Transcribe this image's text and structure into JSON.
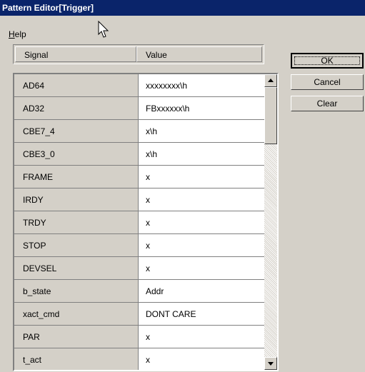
{
  "window": {
    "title": "Pattern Editor[Trigger]"
  },
  "menu": {
    "help_label": "Help"
  },
  "table": {
    "columns": {
      "signal": "Signal",
      "value": "Value"
    },
    "rows": [
      {
        "signal": "AD64",
        "value": "xxxxxxxx\\h"
      },
      {
        "signal": "AD32",
        "value": "FBxxxxxx\\h"
      },
      {
        "signal": "CBE7_4",
        "value": "x\\h"
      },
      {
        "signal": "CBE3_0",
        "value": "x\\h"
      },
      {
        "signal": "FRAME",
        "value": "x"
      },
      {
        "signal": "IRDY",
        "value": "x"
      },
      {
        "signal": "TRDY",
        "value": "x"
      },
      {
        "signal": "STOP",
        "value": "x"
      },
      {
        "signal": "DEVSEL",
        "value": "x"
      },
      {
        "signal": "b_state",
        "value": "Addr"
      },
      {
        "signal": "xact_cmd",
        "value": "DONT CARE"
      },
      {
        "signal": "PAR",
        "value": "x"
      },
      {
        "signal": "t_act",
        "value": "x"
      }
    ]
  },
  "buttons": {
    "ok": "OK",
    "cancel": "Cancel",
    "clear": "Clear"
  },
  "icons": {
    "cursor": "mouse-pointer-icon",
    "scroll_up": "arrow-up-icon",
    "scroll_down": "arrow-down-icon"
  }
}
